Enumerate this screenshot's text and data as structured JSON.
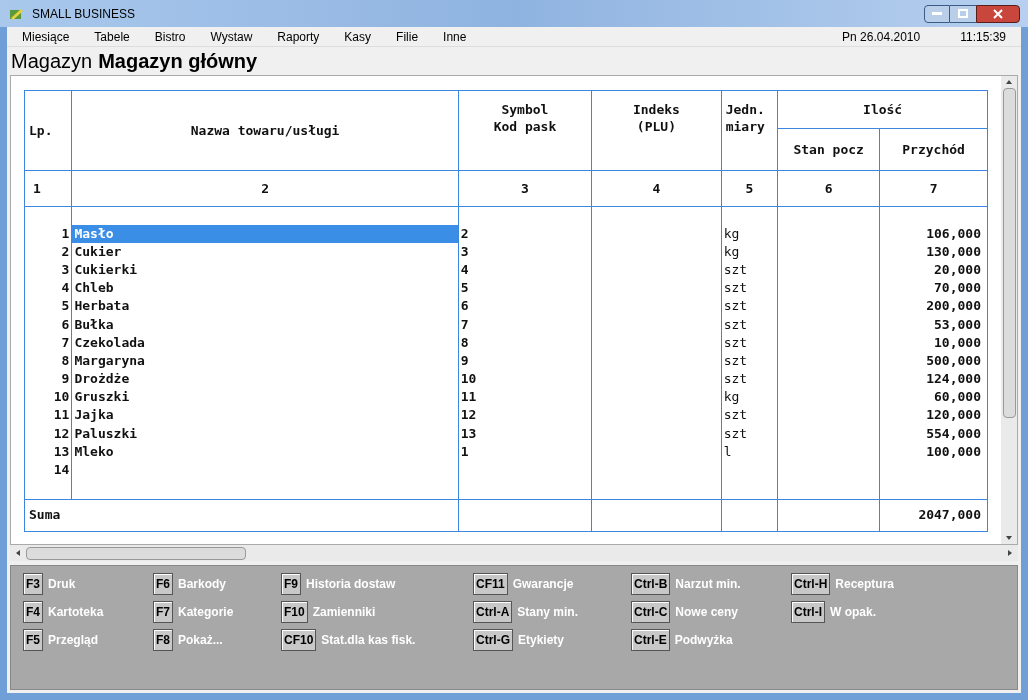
{
  "window": {
    "title": "SMALL BUSINESS"
  },
  "menu": [
    "Miesiące",
    "Tabele",
    "Bistro",
    "Wystaw",
    "Raporty",
    "Kasy",
    "Filie",
    "Inne"
  ],
  "date": "Pn 26.04.2010",
  "time": "11:15:39",
  "heading": {
    "prefix": "Magazyn",
    "name": "Magazyn główny"
  },
  "table": {
    "columns": [
      {
        "label": "Lp.",
        "number": "1"
      },
      {
        "label": "Nazwa towaru/usługi",
        "number": "2"
      },
      {
        "label": "Symbol\nKod pask",
        "number": "3"
      },
      {
        "label": "Indeks\n(PLU)",
        "number": "4"
      },
      {
        "label": "Jedn.\nmiary",
        "number": "5"
      },
      {
        "label": "Stan pocz",
        "number": "6"
      },
      {
        "label": "Przychód",
        "number": "7"
      }
    ],
    "group_label": "Ilość",
    "rows": [
      {
        "lp": "1",
        "name": "Masło",
        "symbol": "2",
        "unit": "kg",
        "income": "106,000",
        "selected": true
      },
      {
        "lp": "2",
        "name": "Cukier",
        "symbol": "3",
        "unit": "kg",
        "income": "130,000",
        "selected": false
      },
      {
        "lp": "3",
        "name": "Cukierki",
        "symbol": "4",
        "unit": "szt",
        "income": "20,000",
        "selected": false
      },
      {
        "lp": "4",
        "name": "Chleb",
        "symbol": "5",
        "unit": "szt",
        "income": "70,000",
        "selected": false
      },
      {
        "lp": "5",
        "name": "Herbata",
        "symbol": "6",
        "unit": "szt",
        "income": "200,000",
        "selected": false
      },
      {
        "lp": "6",
        "name": "Bułka",
        "symbol": "7",
        "unit": "szt",
        "income": "53,000",
        "selected": false
      },
      {
        "lp": "7",
        "name": "Czekolada",
        "symbol": "8",
        "unit": "szt",
        "income": "10,000",
        "selected": false
      },
      {
        "lp": "8",
        "name": "Margaryna",
        "symbol": "9",
        "unit": "szt",
        "income": "500,000",
        "selected": false
      },
      {
        "lp": "9",
        "name": "Drożdże",
        "symbol": "10",
        "unit": "szt",
        "income": "124,000",
        "selected": false
      },
      {
        "lp": "10",
        "name": "Gruszki",
        "symbol": "11",
        "unit": "kg",
        "income": "60,000",
        "selected": false
      },
      {
        "lp": "11",
        "name": "Jajka",
        "symbol": "12",
        "unit": "szt",
        "income": "120,000",
        "selected": false
      },
      {
        "lp": "12",
        "name": "Paluszki",
        "symbol": "13",
        "unit": "szt",
        "income": "554,000",
        "selected": false
      },
      {
        "lp": "13",
        "name": "Mleko",
        "symbol": "1",
        "unit": "l",
        "income": "100,000",
        "selected": false
      },
      {
        "lp": "14",
        "selected": false
      }
    ],
    "total": {
      "label": "Suma",
      "income": "2047,000"
    }
  },
  "function_keys": [
    [
      {
        "key": "F3",
        "label": "Druk"
      },
      {
        "key": "F6",
        "label": "Barkody"
      },
      {
        "key": "F9",
        "label": "Historia dostaw"
      },
      {
        "key": "CF11",
        "label": "Gwarancje"
      },
      {
        "key": "Ctrl-B",
        "label": "Narzut min."
      },
      {
        "key": "Ctrl-H",
        "label": "Receptura"
      }
    ],
    [
      {
        "key": "F4",
        "label": "Kartoteka"
      },
      {
        "key": "F7",
        "label": "Kategorie"
      },
      {
        "key": "F10",
        "label": "Zamienniki"
      },
      {
        "key": "Ctrl-A",
        "label": "Stany min."
      },
      {
        "key": "Ctrl-C",
        "label": "Nowe ceny"
      },
      {
        "key": "Ctrl-I",
        "label": "W opak."
      }
    ],
    [
      {
        "key": "F5",
        "label": "Przegląd"
      },
      {
        "key": "F8",
        "label": "Pokaż..."
      },
      {
        "key": "CF10",
        "label": "Stat.dla kas fisk."
      },
      {
        "key": "Ctrl-G",
        "label": "Etykiety"
      },
      {
        "key": "Ctrl-E",
        "label": "Podwyżka"
      }
    ]
  ]
}
